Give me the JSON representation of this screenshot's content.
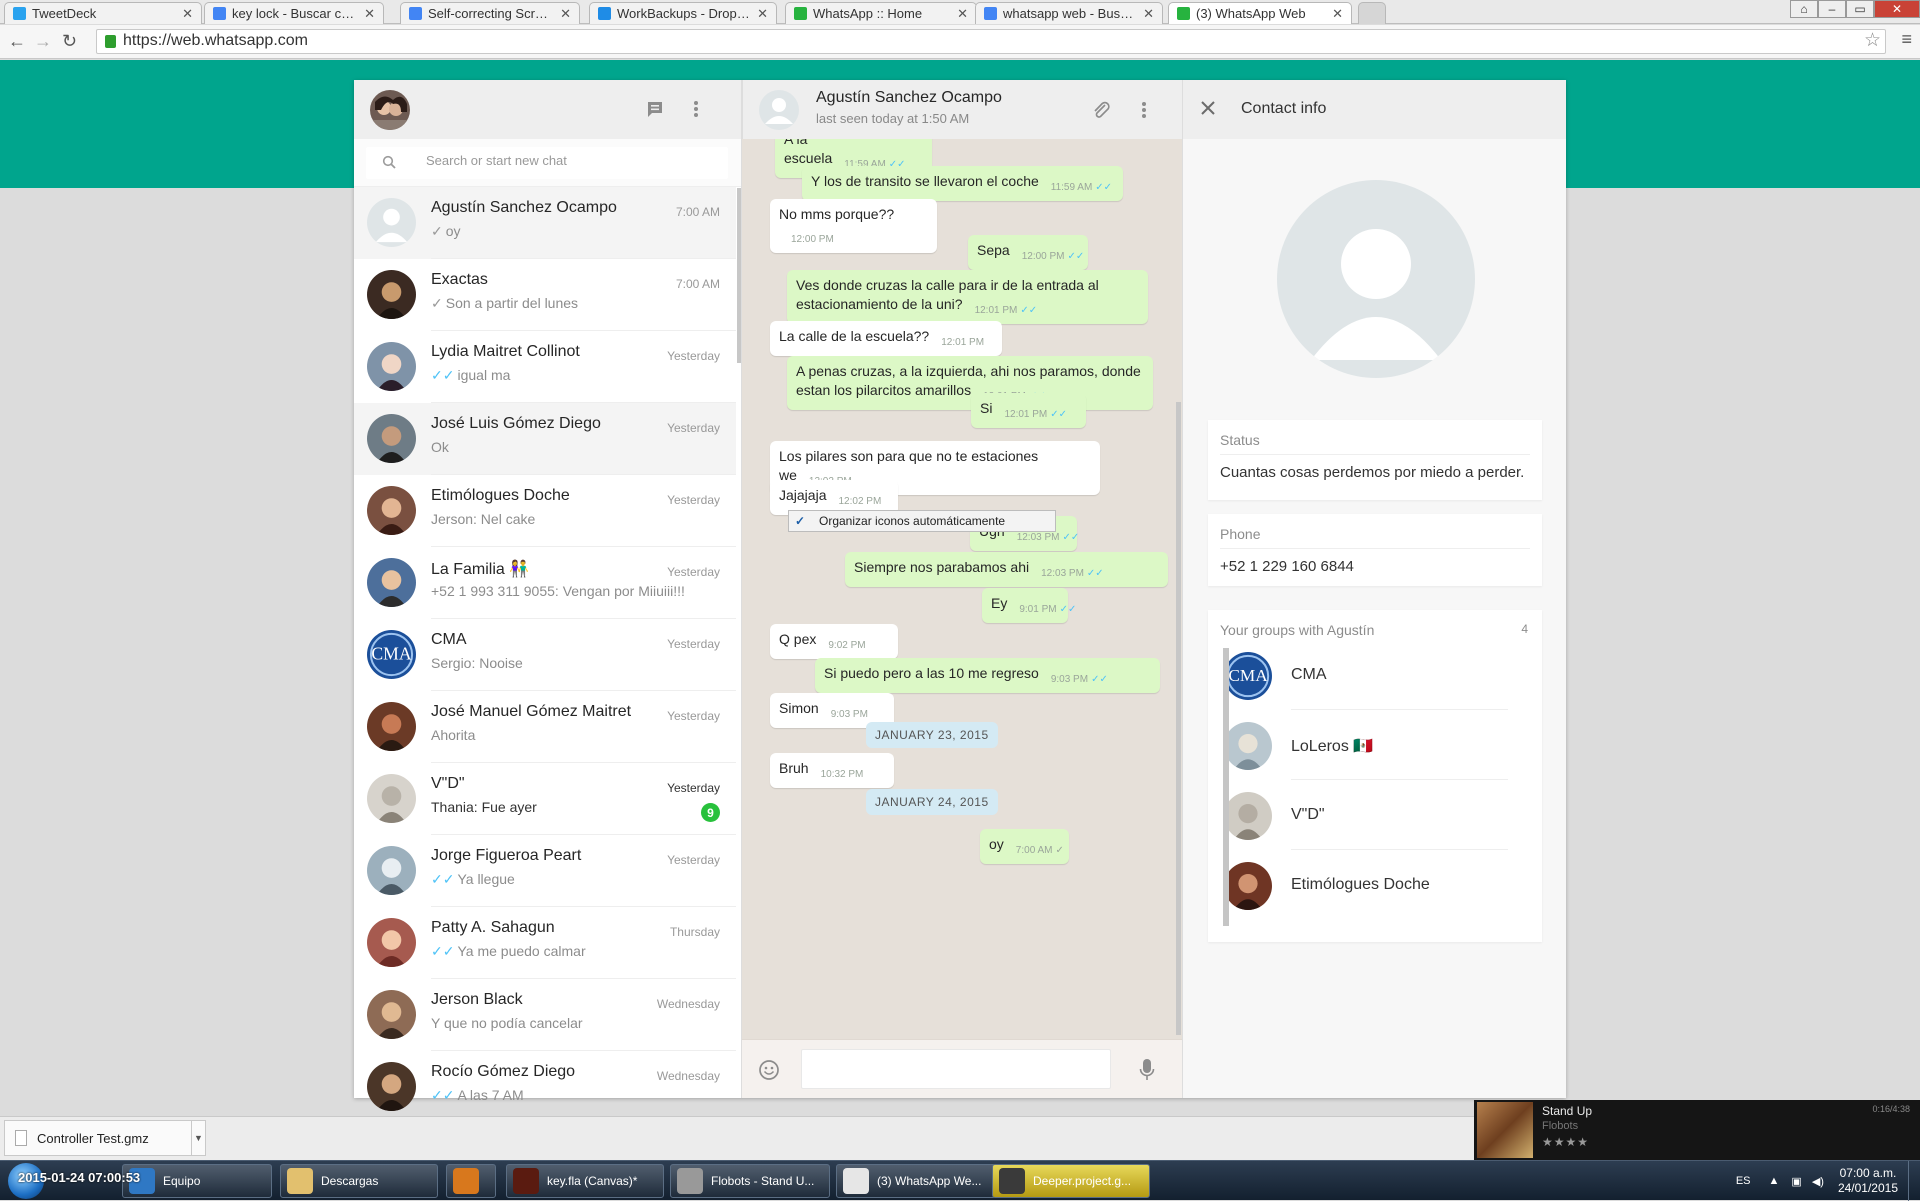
{
  "browser": {
    "tabs": [
      {
        "title": "TweetDeck",
        "color": "#2aa3ef"
      },
      {
        "title": "key lock - Buscar con Google",
        "color": "#4285f4"
      },
      {
        "title": "Self-correcting Screen Sha",
        "color": "#4285f4"
      },
      {
        "title": "WorkBackups - Dropbox",
        "color": "#1f8ce6"
      },
      {
        "title": "WhatsApp :: Home",
        "color": "#27b33f"
      },
      {
        "title": "whatsapp web - Buscar con",
        "color": "#4285f4"
      },
      {
        "title": "(3) WhatsApp Web",
        "color": "#27b33f"
      }
    ],
    "url": "https://web.whatsapp.com"
  },
  "sidebar": {
    "search_placeholder": "Search or start new chat",
    "chats": [
      {
        "name": "Agustín Sanchez Ocampo",
        "time": "7:00 AM",
        "preview": "oy",
        "tick": "✓",
        "tick_color": "grey",
        "selected": true
      },
      {
        "name": "Exactas",
        "time": "7:00 AM",
        "preview": "Son a partir del lunes",
        "tick": "✓",
        "tick_color": "grey"
      },
      {
        "name": "Lydia Maitret Collinot",
        "time": "Yesterday",
        "preview": "igual ma",
        "tick": "✓✓",
        "tick_color": "blue"
      },
      {
        "name": "José Luis Gómez Diego",
        "time": "Yesterday",
        "preview": "Ok",
        "tick": "",
        "hover": true
      },
      {
        "name": "Etimólogues Doche",
        "time": "Yesterday",
        "preview": "Jerson: Nel cake",
        "tick": ""
      },
      {
        "name": "La Familia 👫",
        "time": "Yesterday",
        "preview": "+52 1 993 311 9055: Vengan por Miiuiii!!!",
        "tick": ""
      },
      {
        "name": "CMA",
        "time": "Yesterday",
        "preview": "Sergio: Nooise",
        "tick": ""
      },
      {
        "name": "José Manuel Gómez Maitret",
        "time": "Yesterday",
        "preview": "Ahorita",
        "tick": ""
      },
      {
        "name": "V\"D\"",
        "time": "Yesterday",
        "preview": "Thania: Fue ayer",
        "tick": "",
        "unread": "9"
      },
      {
        "name": "Jorge Figueroa Peart",
        "time": "Yesterday",
        "preview": "Ya llegue",
        "tick": "✓✓",
        "tick_color": "blue"
      },
      {
        "name": "Patty A. Sahagun",
        "time": "Thursday",
        "preview": "Ya me puedo calmar",
        "tick": "✓✓",
        "tick_color": "blue"
      },
      {
        "name": "Jerson Black",
        "time": "Wednesday",
        "preview": "Y que no podía cancelar",
        "tick": ""
      },
      {
        "name": "Rocío Gómez Diego",
        "time": "Wednesday",
        "preview": "A las 7 AM",
        "tick": "✓✓",
        "tick_color": "blue"
      }
    ]
  },
  "conversation": {
    "contact_name": "Agustín Sanchez Ocampo",
    "last_seen": "last seen today at 1:50 AM",
    "context_menu_item": "Organizar iconos automáticamente",
    "context_menu_check": "✓",
    "messages": [
      {
        "dir": "out",
        "text": "A la escuela",
        "time": "11:59 AM",
        "ticks": "✓✓"
      },
      {
        "dir": "out",
        "text": "Y los de transito se llevaron el coche",
        "time": "11:59 AM",
        "ticks": "✓✓"
      },
      {
        "dir": "in",
        "text": "No mms porque??",
        "time": "12:00 PM"
      },
      {
        "dir": "out",
        "text": "Sepa",
        "time": "12:00 PM",
        "ticks": "✓✓"
      },
      {
        "dir": "out",
        "text": "Ves donde cruzas la calle para ir de la entrada al estacionamiento de la uni?",
        "time": "12:01 PM",
        "ticks": "✓✓"
      },
      {
        "dir": "in",
        "text": "La calle de la escuela??",
        "time": "12:01 PM"
      },
      {
        "dir": "out",
        "text": "A penas cruzas, a la izquierda, ahi nos paramos, donde estan los pilarcitos amarillos",
        "time": "12:01 PM",
        "ticks": "✓✓"
      },
      {
        "dir": "out",
        "text": "Si",
        "time": "12:01 PM",
        "ticks": "✓✓"
      },
      {
        "dir": "in",
        "text": "Los pilares son para que no te estaciones we",
        "time": "12:02 PM"
      },
      {
        "dir": "in",
        "text": "Jajajaja",
        "time": "12:02 PM"
      },
      {
        "dir": "out",
        "text": "Ugh",
        "time": "12:03 PM",
        "ticks": "✓✓"
      },
      {
        "dir": "out",
        "text": "Siempre nos parabamos ahi",
        "time": "12:03 PM",
        "ticks": "✓✓"
      },
      {
        "dir": "out",
        "text": "Ey",
        "time": "9:01 PM",
        "ticks": "✓✓"
      },
      {
        "dir": "in",
        "text": "Q pex",
        "time": "9:02 PM"
      },
      {
        "dir": "out",
        "text": "Si puedo pero a las 10 me regreso",
        "time": "9:03 PM",
        "ticks": "✓✓"
      },
      {
        "dir": "in",
        "text": "Simon",
        "time": "9:03 PM"
      },
      {
        "dir": "date",
        "text": "JANUARY 23, 2015"
      },
      {
        "dir": "in",
        "text": "Bruh",
        "time": "10:32 PM"
      },
      {
        "dir": "date",
        "text": "JANUARY 24, 2015"
      },
      {
        "dir": "out",
        "text": "oy",
        "time": "7:00 AM",
        "ticks": "✓",
        "ticks_grey": true
      }
    ]
  },
  "contact_info": {
    "title": "Contact info",
    "status_label": "Status",
    "status_value": "Cuantas cosas perdemos por miedo a perder.",
    "phone_label": "Phone",
    "phone_value": "+52 1 229 160 6844",
    "groups_label": "Your groups with Agustín",
    "groups_count": "4",
    "groups": [
      "CMA",
      "LoLeros 🇲🇽",
      "V\"D\"",
      "Etimólogues Doche"
    ]
  },
  "downloads": {
    "file": "Controller Test.gmz"
  },
  "media_player": {
    "song": "Stand Up",
    "artist": "Flobots",
    "stars": "★★★★",
    "duration": "0:16/4:38"
  },
  "taskbar": {
    "items": [
      "Equipo",
      "Descargas",
      "",
      "key.fla (Canvas)*",
      "Flobots - Stand U...",
      "(3) WhatsApp We...",
      "Deeper.project.g..."
    ],
    "overlay_text": "2015-01-24 07:00:53",
    "language": "ES",
    "time": "07:00 a.m.",
    "date": "24/01/2015"
  }
}
